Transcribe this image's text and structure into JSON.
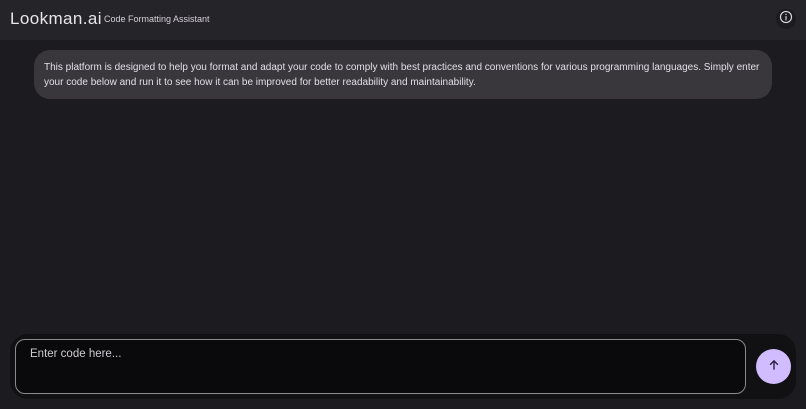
{
  "header": {
    "brand": "Lookman.ai",
    "subtitle": "Code Formatting Assistant",
    "info_icon": "info-icon"
  },
  "messages": [
    {
      "role": "assistant",
      "text": "This platform is designed to help you format and adapt your code to comply with best practices and conventions for various programming languages. Simply enter your code below and run it to see how it can be improved for better readability and maintainability."
    }
  ],
  "composer": {
    "placeholder": "Enter code here...",
    "value": "",
    "send_icon": "arrow-up-icon"
  },
  "colors": {
    "background": "#1c1b1f",
    "topbar": "#252428",
    "message_bubble": "#39373c",
    "send_button": "#d0bcff"
  }
}
